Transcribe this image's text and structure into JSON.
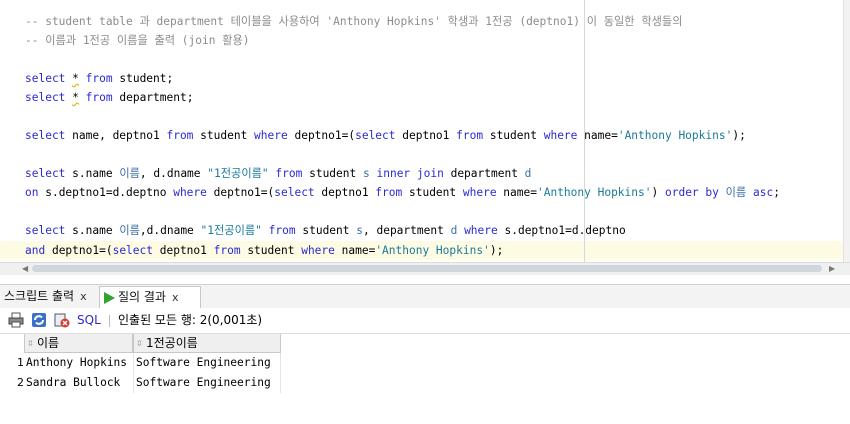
{
  "editor": {
    "comment1": "-- student table 과 department 테이블을 사용하여 'Anthony Hopkins' 학생과 1전공 (deptno1) 이 동일한 학생들의",
    "comment2": "-- 이름과 1전공 이름을 출력 (join 활용)",
    "l3": {
      "k1": "select",
      "star": "*",
      "k2": "from",
      "t": " student;"
    },
    "l4": {
      "k1": "select",
      "star": "*",
      "k2": "from",
      "t": " department;"
    },
    "l5": {
      "k1": "select",
      "t1": " name, deptno1 ",
      "k2": "from",
      "t2": " student ",
      "k3": "where",
      "t3": " deptno1=(",
      "k4": "select",
      "t4": " deptno1 ",
      "k5": "from",
      "t5": " student ",
      "k6": "where",
      "t6": " name=",
      "s1": "'Anthony Hopkins'",
      "t7": ");"
    },
    "l6": {
      "k1": "select",
      "t1": " s.name ",
      "a1": "이름",
      "t2": ", d.dname ",
      "s1": "\"1전공이름\"",
      "t3": " ",
      "k2": "from",
      "t4": " student ",
      "a2": "s",
      "t5": " ",
      "k3": "inner join",
      "t6": " department ",
      "a3": "d"
    },
    "l7": {
      "k1": "on",
      "t1": " s.deptno1=d.deptno ",
      "k2": "where",
      "t2": " deptno1=(",
      "k3": "select",
      "t3": " deptno1 ",
      "k4": "from",
      "t4": " student ",
      "k5": "where",
      "t5": " name=",
      "s1": "'Anthony Hopkins'",
      "t6": ") ",
      "k6": "order by",
      "t7": " ",
      "a1": "이름",
      "t8": " ",
      "k7": "asc",
      "t9": ";"
    },
    "l8": {
      "k1": "select",
      "t1": " s.name ",
      "a1": "이름",
      "t2": ",d.dname ",
      "s1": "\"1전공이름\"",
      "t3": " ",
      "k2": "from",
      "t4": " student ",
      "a2": "s",
      "t5": ", department ",
      "a3": "d",
      "t6": " ",
      "k3": "where",
      "t7": " s.deptno1=d.deptno"
    },
    "l9": {
      "k1": "and",
      "t1": " deptno1=(",
      "k2": "select",
      "t2": " deptno1 ",
      "k3": "from",
      "t3": " student ",
      "k4": "where",
      "t4": " name=",
      "s1": "'Anthony Hopkins'",
      "t5": ");"
    }
  },
  "tabs": [
    {
      "label": "스크립트 출력",
      "close": "x"
    },
    {
      "label": "질의 결과",
      "close": "x"
    }
  ],
  "toolbar": {
    "sql_label": "SQL",
    "status": "인출된 모든 행: 2(0,001초)"
  },
  "grid": {
    "columns": [
      "이름",
      "1전공이름"
    ],
    "rows": [
      {
        "num": "1",
        "name": "Anthony Hopkins",
        "dept": "Software Engineering"
      },
      {
        "num": "2",
        "name": "Sandra Bullock",
        "dept": "Software Engineering"
      }
    ]
  },
  "colors": {
    "keyword": "#2a2ad2",
    "string": "#1a7a9a",
    "comment": "#8c8c8c",
    "current_line": "#fdfbe4"
  },
  "icons": [
    "print-icon",
    "refresh-icon",
    "cancel-icon",
    "play-icon",
    "sort-icon"
  ]
}
